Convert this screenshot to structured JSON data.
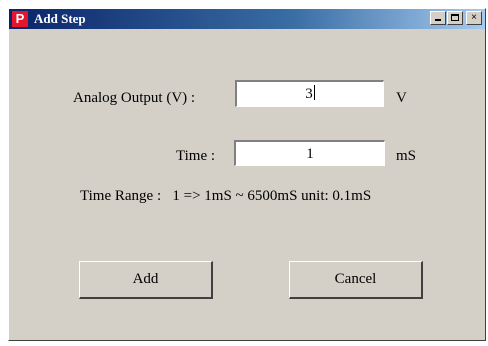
{
  "window": {
    "title": "Add Step",
    "app_icon_letter": "P",
    "controls": {
      "minimize": "minimize-icon",
      "maximize": "maximize-icon",
      "close_glyph": "×"
    }
  },
  "form": {
    "analog_output": {
      "label": "Analog Output (V) :",
      "value": "3",
      "unit": "V"
    },
    "time": {
      "label": "Time :",
      "value": "1",
      "unit": "mS"
    },
    "time_range_text": "Time Range :   1 => 1mS ~ 6500mS unit: 0.1mS"
  },
  "buttons": {
    "add": "Add",
    "cancel": "Cancel"
  },
  "colors": {
    "title_start": "#0a246a",
    "title_end": "#a6caf0",
    "face": "#d4d0c8",
    "icon_red": "#e3162c"
  }
}
